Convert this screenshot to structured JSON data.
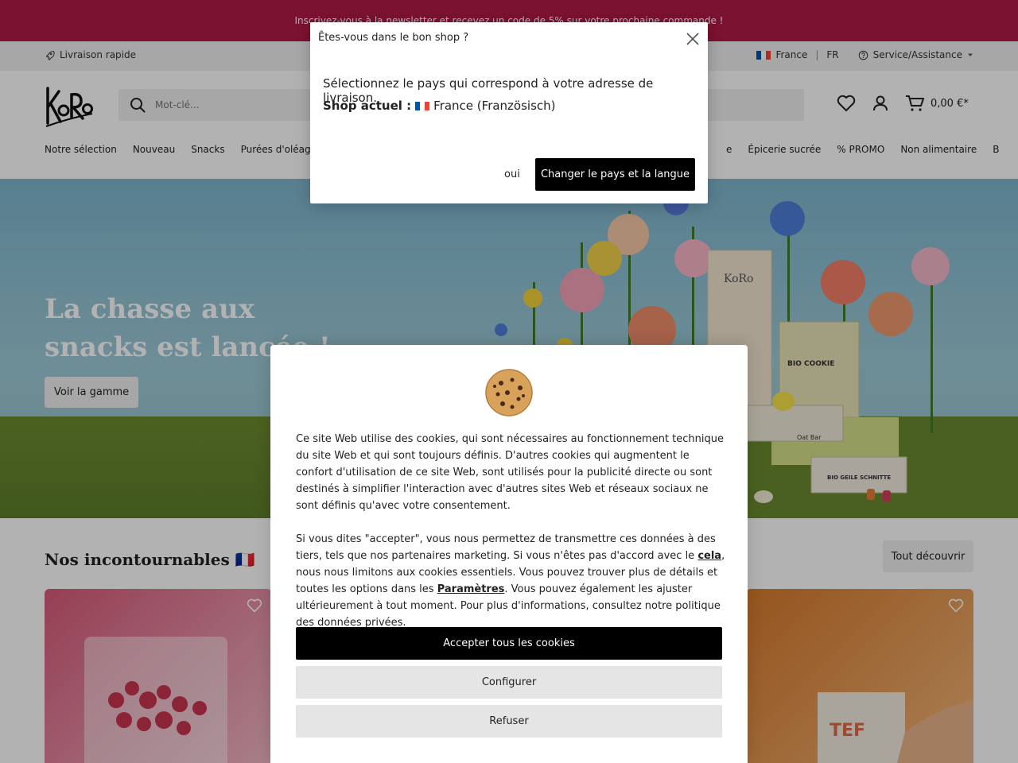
{
  "promo_bar": {
    "text": "Inscrivez-vous à la newsletter et recevez un code de 5% sur votre prochaine commande !"
  },
  "top_bar": {
    "delivery": "Livraison rapide",
    "country": "France",
    "language": "FR",
    "service": "Service/Assistance"
  },
  "header": {
    "logo_text": "KoRo",
    "search_placeholder": "Mot-clé...",
    "cart_total": "0,00 €*"
  },
  "nav": {
    "left": [
      "Notre sélection",
      "Nouveau",
      "Snacks",
      "Purées d'oléagin"
    ],
    "right_partial": "e",
    "right": [
      "Épicerie sucrée",
      "% PROMO",
      "Non alimentaire",
      "B"
    ]
  },
  "hero": {
    "title": "La chasse aux snacks est lancée !",
    "cta": "Voir la gamme"
  },
  "section": {
    "title": "Nos incontournables 🇫🇷",
    "see_all": "Tout découvrir"
  },
  "country_modal": {
    "title": "Êtes-vous dans le bon shop ?",
    "line1": "Sélectionnez le pays qui correspond à votre adresse de livraison.",
    "current_label": "Shop actuel :",
    "current_value": "France (Französisch)",
    "yes": "oui",
    "change": "Changer le pays et la langue"
  },
  "cookie_modal": {
    "para1": "Ce site Web utilise des cookies, qui sont nécessaires au fonctionnement technique du site Web et qui sont toujours définis. D'autres cookies qui augmentent le confort d'utilisation de ce site Web, sont utilisés pour la publicité directe ou sont destinés à simplifier l'interaction avec d'autres sites Web et réseaux sociaux ne sont définis qu'avec votre consentement.",
    "para2_a": "Si vous dites \"accepter\", vous nous permettez de transmettre ces données à des tiers, tels que nos partenaires marketing. Si vous n'êtes pas d'accord avec le ",
    "link_cela": "cela",
    "para2_b": ", nous nous limitons aux cookies essentiels. Vous pouvez trouver plus de détails et toutes les options dans les ",
    "link_params": "Paramètres",
    "para2_c": ". Vous pouvez également les ajuster ultérieurement à tout moment. Pour plus d'informations, consultez notre politique des données privées.",
    "accept": "Accepter tous les cookies",
    "configure": "Configurer",
    "refuse": "Refuser"
  },
  "colors": {
    "promo_bg": "#b01a47",
    "primary_button": "#000000",
    "secondary_button": "#e5e5e5"
  }
}
